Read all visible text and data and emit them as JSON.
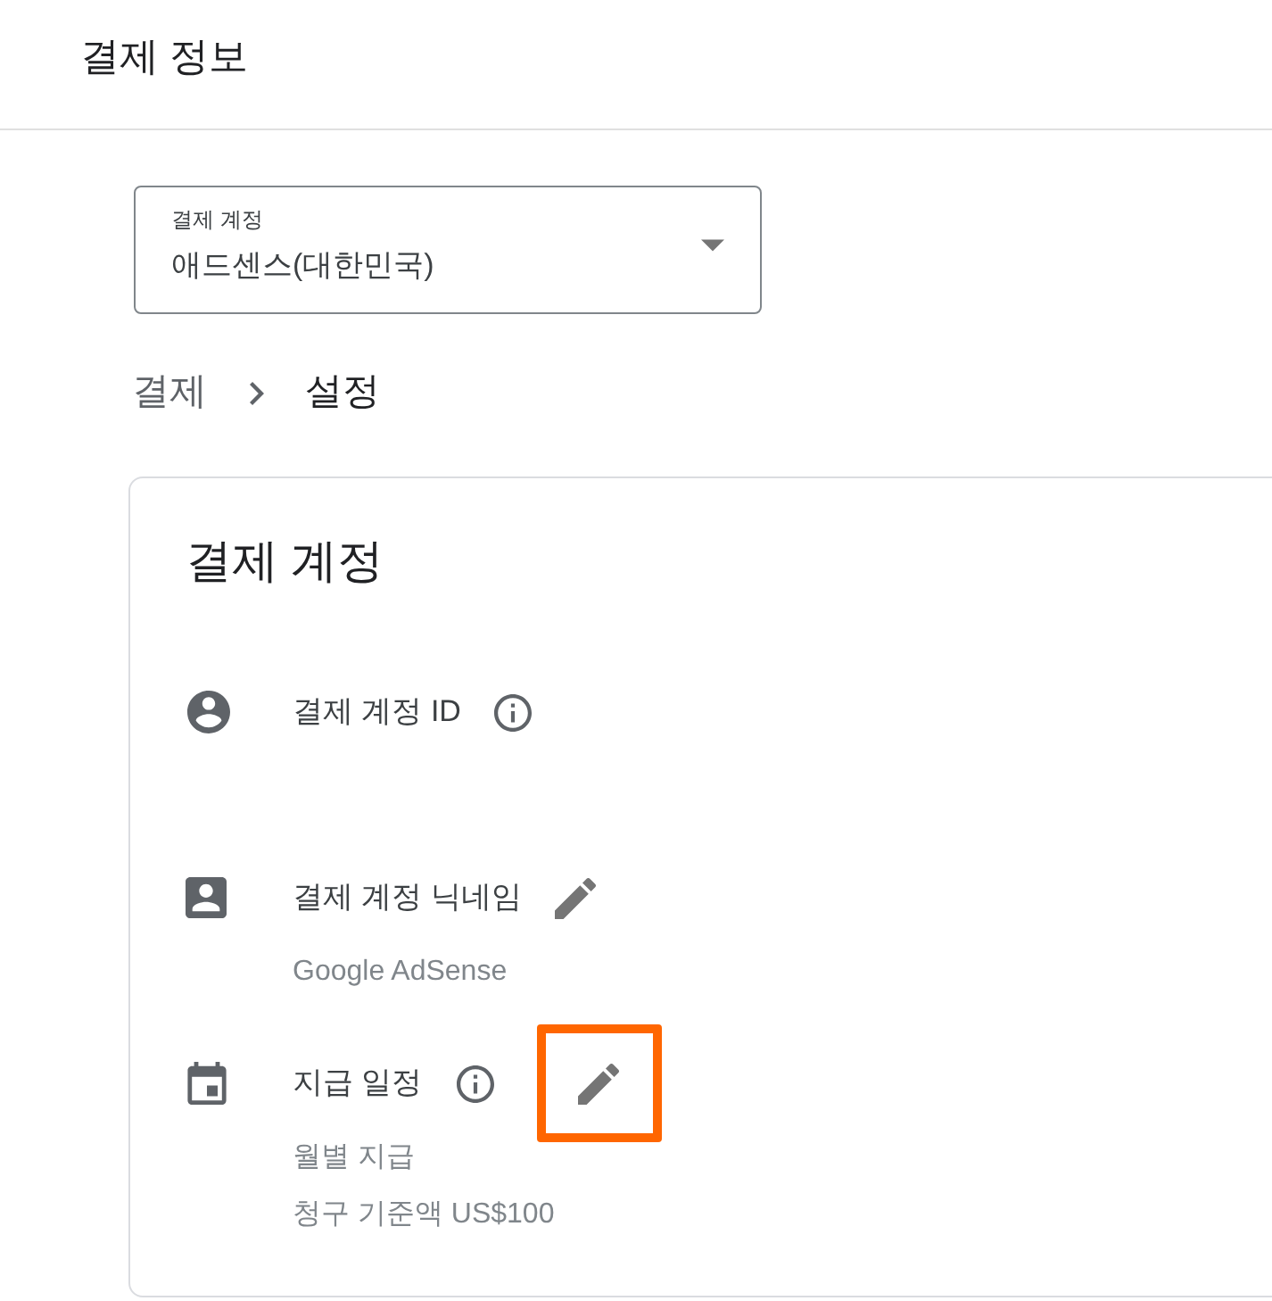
{
  "header": {
    "title": "결제 정보"
  },
  "account_select": {
    "label": "결제 계정",
    "value": "애드센스(대한민국)"
  },
  "breadcrumb": [
    {
      "label": "결제",
      "current": false
    },
    {
      "label": "설정",
      "current": true
    }
  ],
  "card": {
    "title": "결제 계정",
    "rows": [
      {
        "kind": "account",
        "label": "결제 계정 ID",
        "info": true,
        "editable": false,
        "highlighted": false
      },
      {
        "kind": "nickname",
        "label": "결제 계정 닉네임",
        "info": false,
        "editable": true,
        "highlighted": false,
        "values": [
          "Google AdSense"
        ]
      },
      {
        "kind": "schedule",
        "label": "지급 일정",
        "info": true,
        "editable": true,
        "highlighted": true,
        "values": [
          "월별 지급",
          "청구 기준액 US$100"
        ]
      }
    ]
  }
}
